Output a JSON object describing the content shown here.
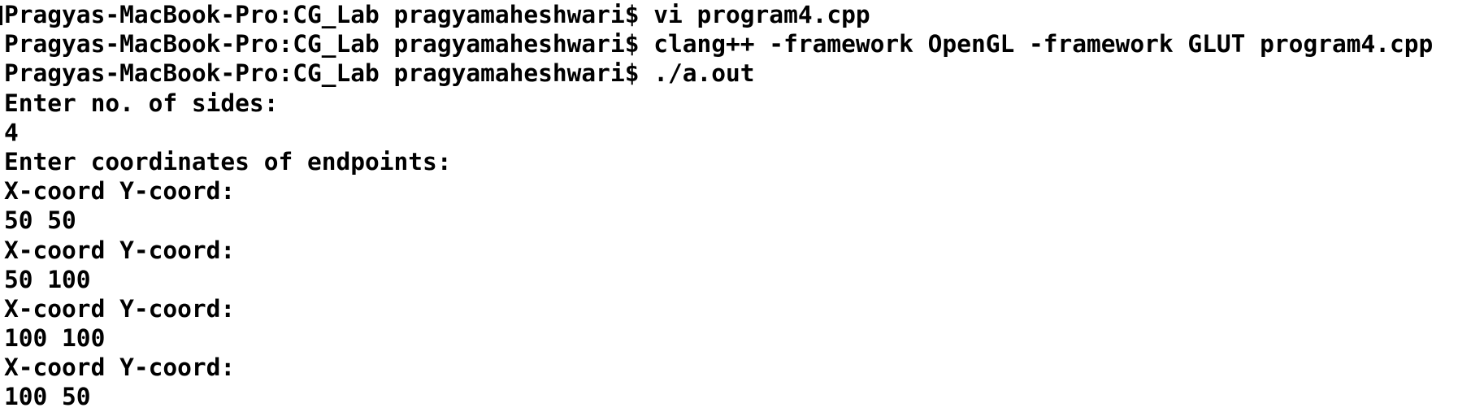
{
  "terminal": {
    "lines": [
      "Pragyas-MacBook-Pro:CG_Lab pragyamaheshwari$ vi program4.cpp",
      "Pragyas-MacBook-Pro:CG_Lab pragyamaheshwari$ clang++ -framework OpenGL -framework GLUT program4.cpp",
      "Pragyas-MacBook-Pro:CG_Lab pragyamaheshwari$ ./a.out",
      "Enter no. of sides:",
      "4",
      "Enter coordinates of endpoints:",
      "X-coord Y-coord:",
      "50 50",
      "X-coord Y-coord:",
      "50 100",
      "X-coord Y-coord:",
      "100 100",
      "X-coord Y-coord:",
      "100 50"
    ]
  },
  "colors": {
    "background": "#ffffff",
    "text": "#000000"
  }
}
